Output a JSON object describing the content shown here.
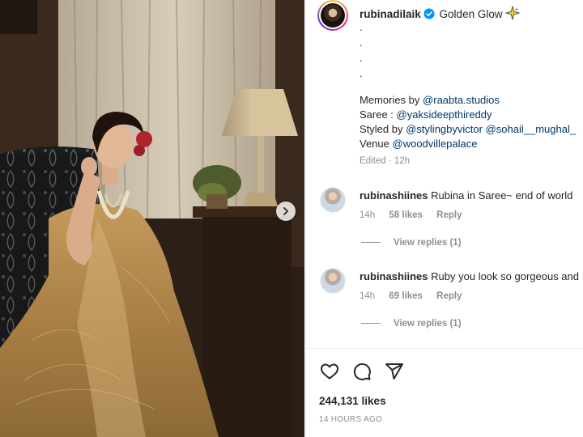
{
  "post": {
    "username": "rubinadilaik",
    "caption": "Golden Glow",
    "dots": [
      ".",
      ".",
      ".",
      "."
    ],
    "memories_label": "Memories by",
    "memories_link": "@raabta.studios",
    "saree_label": "Saree :",
    "saree_link": "@yaksideepthireddy",
    "styled_label": "Styled by",
    "styled_link1": "@stylingbyvictor",
    "styled_link2": "@sohail__mughal_",
    "venue_label": "Venue",
    "venue_link": "@woodvillepalace",
    "edited": "Edited · 12h",
    "likes": "244,131 likes",
    "time_ago": "14 HOURS AGO"
  },
  "comments": [
    {
      "user": "rubinashiines",
      "text": "Rubina in Saree~ end of world",
      "time": "14h",
      "likes": "58 likes",
      "reply": "Reply",
      "view_replies": "View replies (1)"
    },
    {
      "user": "rubinashiines",
      "text": "Ruby you look so gorgeous and",
      "time": "14h",
      "likes": "69 likes",
      "reply": "Reply",
      "view_replies": "View replies (1)"
    }
  ],
  "icons": {
    "verified": "verified-badge-icon",
    "sparkle": "sparkle-emoji-icon",
    "next": "chevron-right-icon",
    "like": "heart-icon",
    "comment": "comment-icon",
    "share": "share-icon"
  },
  "colors": {
    "link": "#00376b",
    "verified": "#0095f6",
    "muted": "#8e8e8e"
  }
}
